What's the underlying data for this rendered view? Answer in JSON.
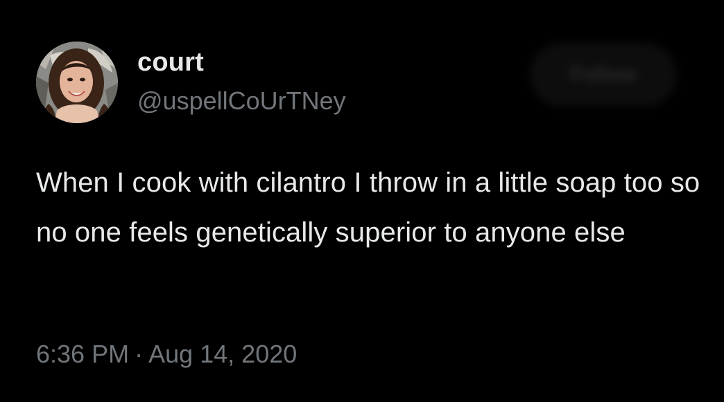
{
  "user": {
    "display_name": "court",
    "handle": "@uspellCoUrTNey",
    "avatar_icon": "profile-photo"
  },
  "follow_button": {
    "label": "Follow"
  },
  "tweet": {
    "text": "When I cook with cilantro I throw in a little soap too so no one feels genetically superior to anyone else",
    "time": "6:36 PM",
    "separator": "·",
    "date": "Aug 14, 2020"
  },
  "colors": {
    "background": "#000000",
    "primary_text": "#e7e9ea",
    "secondary_text": "#71767b"
  }
}
